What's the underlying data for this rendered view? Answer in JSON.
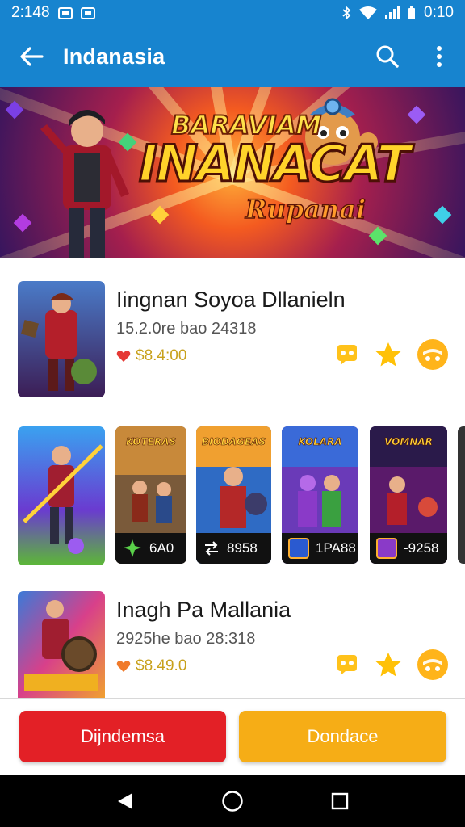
{
  "status_bar": {
    "time": "2:148",
    "clock": "0:10",
    "icons": [
      "notification-box-icon",
      "notification-box-icon",
      "bluetooth-icon",
      "wifi-icon",
      "signal-icon",
      "battery-icon"
    ]
  },
  "app_bar": {
    "title": "Indanasia",
    "icons": [
      "back-arrow-icon",
      "search-icon",
      "more-vert-icon"
    ]
  },
  "banner": {
    "line1": "BARAVIAM",
    "line2": "INANACAT",
    "line3": "Rupanai"
  },
  "games": [
    {
      "name": "Iingnan Soyoa Dllanieln",
      "meta": "15.2.0re bao 24318",
      "price": "$8.4:00",
      "icons": [
        "chat-icon",
        "star-icon",
        "coin-icon"
      ]
    },
    {
      "name": "Inagh Pa Mallania",
      "meta": "2925he bao 28:318",
      "price": "$8.49.0",
      "icons": [
        "chat-icon",
        "star-icon",
        "coin-icon"
      ]
    }
  ],
  "carousel": [
    {
      "title": "",
      "caption": ""
    },
    {
      "title": "KOTERAS",
      "caption": "6A0"
    },
    {
      "title": "BIODAGEAS",
      "caption": "8958"
    },
    {
      "title": "KOLARA",
      "caption": "1PA88"
    },
    {
      "title": "VOMNAR",
      "caption": "-9258"
    }
  ],
  "buttons": {
    "primary": "Dijndemsa",
    "secondary": "Dondace"
  },
  "nav": {
    "icons": [
      "back-triangle-icon",
      "home-circle-icon",
      "recents-square-icon"
    ]
  },
  "colors": {
    "app_bar": "#1784cf",
    "button_red": "#e32026",
    "button_yellow": "#f6ad16",
    "price_heart": "#e53935",
    "star": "#ffc107"
  }
}
